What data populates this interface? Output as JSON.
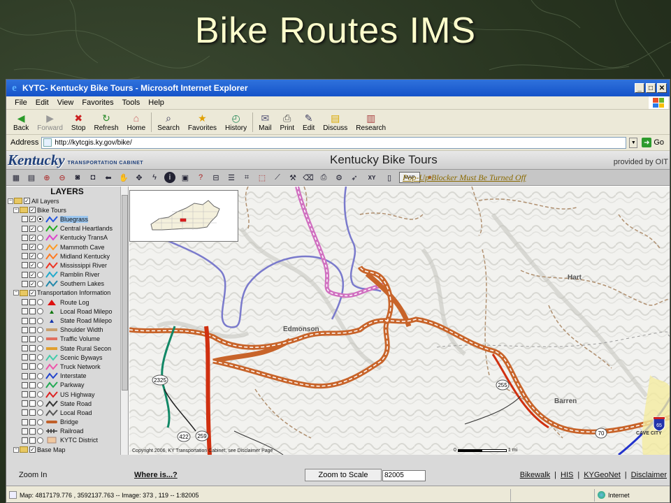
{
  "slide": {
    "title": "Bike Routes IMS"
  },
  "browser": {
    "window_title": "KYTC- Kentucky Bike Tours - Microsoft Internet Explorer",
    "menu": [
      "File",
      "Edit",
      "View",
      "Favorites",
      "Tools",
      "Help"
    ],
    "toolbar": [
      {
        "label": "Back",
        "icon": "back-arrow-icon"
      },
      {
        "label": "Forward",
        "icon": "forward-arrow-icon"
      },
      {
        "label": "Stop",
        "icon": "stop-icon"
      },
      {
        "label": "Refresh",
        "icon": "refresh-icon"
      },
      {
        "label": "Home",
        "icon": "home-icon"
      },
      {
        "label": "Search",
        "icon": "search-icon"
      },
      {
        "label": "Favorites",
        "icon": "star-icon"
      },
      {
        "label": "History",
        "icon": "history-icon"
      },
      {
        "label": "Mail",
        "icon": "mail-icon"
      },
      {
        "label": "Print",
        "icon": "print-icon"
      },
      {
        "label": "Edit",
        "icon": "edit-icon"
      },
      {
        "label": "Discuss",
        "icon": "discuss-icon"
      },
      {
        "label": "Research",
        "icon": "research-icon"
      }
    ],
    "address_label": "Address",
    "address_value": "http://kytcgis.ky.gov/bike/",
    "go_label": "Go",
    "status_text": "Map: 4817179.776 , 3592137.763 -- Image: 373 , 119 -- 1:82005",
    "zone": "Internet"
  },
  "page": {
    "logo_text": "Kentucky",
    "logo_sub": "TRANSPORTATION CABINET",
    "title": "Kentucky Bike Tours",
    "provided_by": "provided by OIT",
    "popup_notice": "Pop-Up Blocker Must Be Turned Off",
    "layers_title": "LAYERS",
    "layers": [
      {
        "label": "All Layers",
        "type": "group",
        "level": 0
      },
      {
        "label": "Bike Tours",
        "type": "group",
        "level": 1
      },
      {
        "label": "Bluegrass",
        "type": "item",
        "color": "#2255dd",
        "selected": true,
        "checked": true,
        "active": true
      },
      {
        "label": "Central Heartlands",
        "type": "item",
        "color": "#22aa22",
        "checked": true
      },
      {
        "label": "Kentucky TransA",
        "type": "item",
        "color": "#dd44cc",
        "checked": true
      },
      {
        "label": "Mammoth Cave",
        "type": "item",
        "color": "#ff9a22",
        "checked": true
      },
      {
        "label": "Midland Kentucky",
        "type": "item",
        "color": "#ff7a22",
        "checked": true
      },
      {
        "label": "Mississippi River",
        "type": "item",
        "color": "#ee3322",
        "checked": true
      },
      {
        "label": "Ramblin River",
        "type": "item",
        "color": "#22aacc",
        "checked": true
      },
      {
        "label": "Southern Lakes",
        "type": "item",
        "color": "#2288aa",
        "checked": true
      },
      {
        "label": "Transportation Information",
        "type": "group",
        "level": 1
      },
      {
        "label": "Route Log",
        "type": "item",
        "sym": "triangle",
        "color": "#dd1111"
      },
      {
        "label": "Local Road Milepo",
        "type": "item",
        "sym": "triangle-small",
        "color": "#117711"
      },
      {
        "label": "State Road Milepo",
        "type": "item",
        "sym": "triangle-small",
        "color": "#1133aa"
      },
      {
        "label": "Shoulder Width",
        "type": "item",
        "sym": "line",
        "color": "#c8a070"
      },
      {
        "label": "Traffic Volume",
        "type": "item",
        "sym": "line",
        "color": "#e07060"
      },
      {
        "label": "State Rural Secon",
        "type": "item",
        "sym": "line",
        "color": "#e0a030"
      },
      {
        "label": "Scenic Byways",
        "type": "item",
        "sym": "zig",
        "color": "#44ccaa"
      },
      {
        "label": "Truck Network",
        "type": "item",
        "sym": "zig",
        "color": "#ee55aa"
      },
      {
        "label": "Interstate",
        "type": "item",
        "sym": "zig",
        "color": "#2244cc"
      },
      {
        "label": "Parkway",
        "type": "item",
        "sym": "zig",
        "color": "#22aa55"
      },
      {
        "label": "US Highway",
        "type": "item",
        "sym": "zig",
        "color": "#dd2222"
      },
      {
        "label": "State Road",
        "type": "item",
        "sym": "zig",
        "color": "#333333"
      },
      {
        "label": "Local Road",
        "type": "item",
        "sym": "zig",
        "color": "#555555"
      },
      {
        "label": "Bridge",
        "type": "item",
        "sym": "bridge",
        "color": "#c0602a"
      },
      {
        "label": "Railroad",
        "type": "item",
        "sym": "rail",
        "color": "#333333"
      },
      {
        "label": "KYTC District",
        "type": "item",
        "sym": "box",
        "color": "#f0c8a0"
      },
      {
        "label": "Base Map",
        "type": "group",
        "level": 1
      }
    ],
    "map": {
      "towns": [
        "Hart",
        "Edmonson",
        "Barren",
        "CAVE CITY"
      ],
      "shields": [
        "2325",
        "422",
        "259",
        "255",
        "70",
        "65"
      ],
      "copyright": "Copyright 2006, KY Transportation Cabinet, see Disclaimer Page",
      "scale_left": "0",
      "scale_right": "1 mi"
    },
    "bottom": {
      "zoom_in": "Zoom In",
      "where_is": "Where is...?",
      "zoom_to_scale": "Zoom to Scale",
      "scale_value": "82005",
      "links": [
        "Bikewalk",
        "HIS",
        "KYGeoNet",
        "Disclaimer"
      ]
    }
  },
  "colors": {
    "title_text": "#ffffcc",
    "xp_titlebar": "#1553c9",
    "route_orange": "#c8642a",
    "route_pink": "#d070c0",
    "route_blue": "#6a6ac8",
    "route_red": "#d03010"
  }
}
